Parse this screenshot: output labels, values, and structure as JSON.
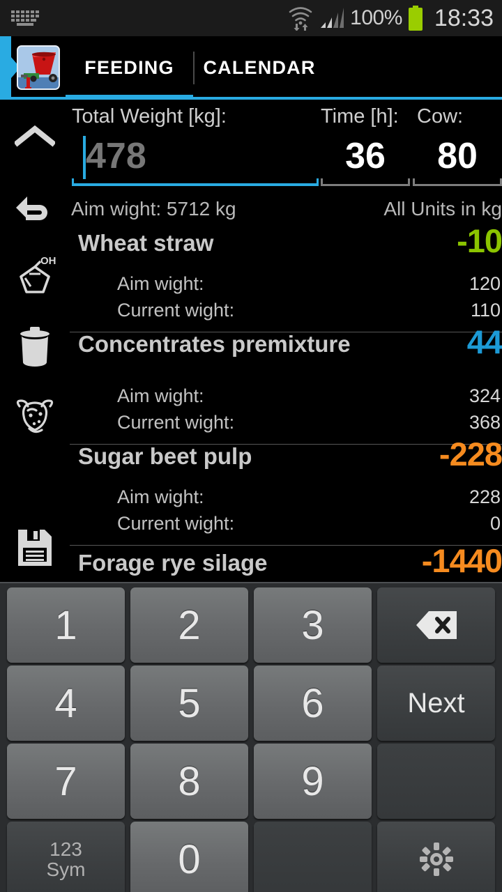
{
  "statusbar": {
    "keyboard_icon": "keyboard-icon",
    "wifi_icon": "wifi-icon",
    "signal_icon": "signal-icon",
    "battery_percent": "100%",
    "battery_icon": "battery-full-icon",
    "clock": "18:33",
    "battery_color": "#9ACD00"
  },
  "actionbar": {
    "app_icon": "feed-mixer-app-icon",
    "accent_color": "#29ABE2",
    "tabs": [
      {
        "label": "FEEDING",
        "selected": true
      },
      {
        "label": "CALENDAR",
        "selected": false
      }
    ]
  },
  "sidebar": {
    "items": [
      {
        "icon": "chevron-up-icon",
        "name": "collapse-button"
      },
      {
        "icon": "undo-icon",
        "name": "undo-button"
      },
      {
        "icon": "chemistry-molecule-icon",
        "name": "additives-button"
      },
      {
        "icon": "trash-icon",
        "name": "delete-button"
      },
      {
        "icon": "cow-head-icon",
        "name": "animals-button"
      },
      {
        "icon": "floppy-disk-icon",
        "name": "save-button"
      }
    ]
  },
  "form": {
    "total_weight_label": "Total Weight [kg]:",
    "total_weight_value": "",
    "total_weight_placeholder": "478",
    "time_label": "Time [h]:",
    "time_value": "36",
    "cow_label": "Cow:",
    "cow_value": "80",
    "aim_weight_summary": "Aim wight: 5712 kg",
    "units_note": "All Units in kg"
  },
  "detail_labels": {
    "aim": "Aim wight:",
    "current": "Current wight:"
  },
  "colors": {
    "green": "#8BC400",
    "blue": "#1C9AD6",
    "orange": "#F68B1F"
  },
  "feed_list": [
    {
      "name": "Wheat straw",
      "delta": "-10",
      "delta_color": "#8BC400",
      "aim_weight": "120",
      "current_weight": "110"
    },
    {
      "name": "Concentrates premixture",
      "delta": "44",
      "delta_color": "#1C9AD6",
      "aim_weight": "324",
      "current_weight": "368"
    },
    {
      "name": "Sugar beet pulp",
      "delta": "-228",
      "delta_color": "#F68B1F",
      "aim_weight": "228",
      "current_weight": "0"
    },
    {
      "name": "Forage rye silage",
      "delta": "-1440",
      "delta_color": "#F68B1F",
      "aim_weight": "",
      "current_weight": ""
    }
  ],
  "keyboard": {
    "rows": [
      [
        {
          "label": "1",
          "type": "num",
          "name": "key-1"
        },
        {
          "label": "2",
          "type": "num",
          "name": "key-2"
        },
        {
          "label": "3",
          "type": "num",
          "name": "key-3"
        },
        {
          "label": "",
          "type": "backspace",
          "name": "key-backspace"
        }
      ],
      [
        {
          "label": "4",
          "type": "num",
          "name": "key-4"
        },
        {
          "label": "5",
          "type": "num",
          "name": "key-5"
        },
        {
          "label": "6",
          "type": "num",
          "name": "key-6"
        },
        {
          "label": "Next",
          "type": "fn",
          "name": "key-next"
        }
      ],
      [
        {
          "label": "7",
          "type": "num",
          "name": "key-7"
        },
        {
          "label": "8",
          "type": "num",
          "name": "key-8"
        },
        {
          "label": "9",
          "type": "num",
          "name": "key-9"
        },
        {
          "label": "",
          "type": "blank",
          "name": "key-blank-1"
        }
      ],
      [
        {
          "label": "123",
          "label2": "Sym",
          "type": "sym",
          "name": "key-symbols"
        },
        {
          "label": "0",
          "type": "num",
          "name": "key-0"
        },
        {
          "label": "",
          "type": "blank",
          "name": "key-blank-2"
        },
        {
          "label": "",
          "type": "gear",
          "name": "key-settings"
        }
      ]
    ]
  }
}
